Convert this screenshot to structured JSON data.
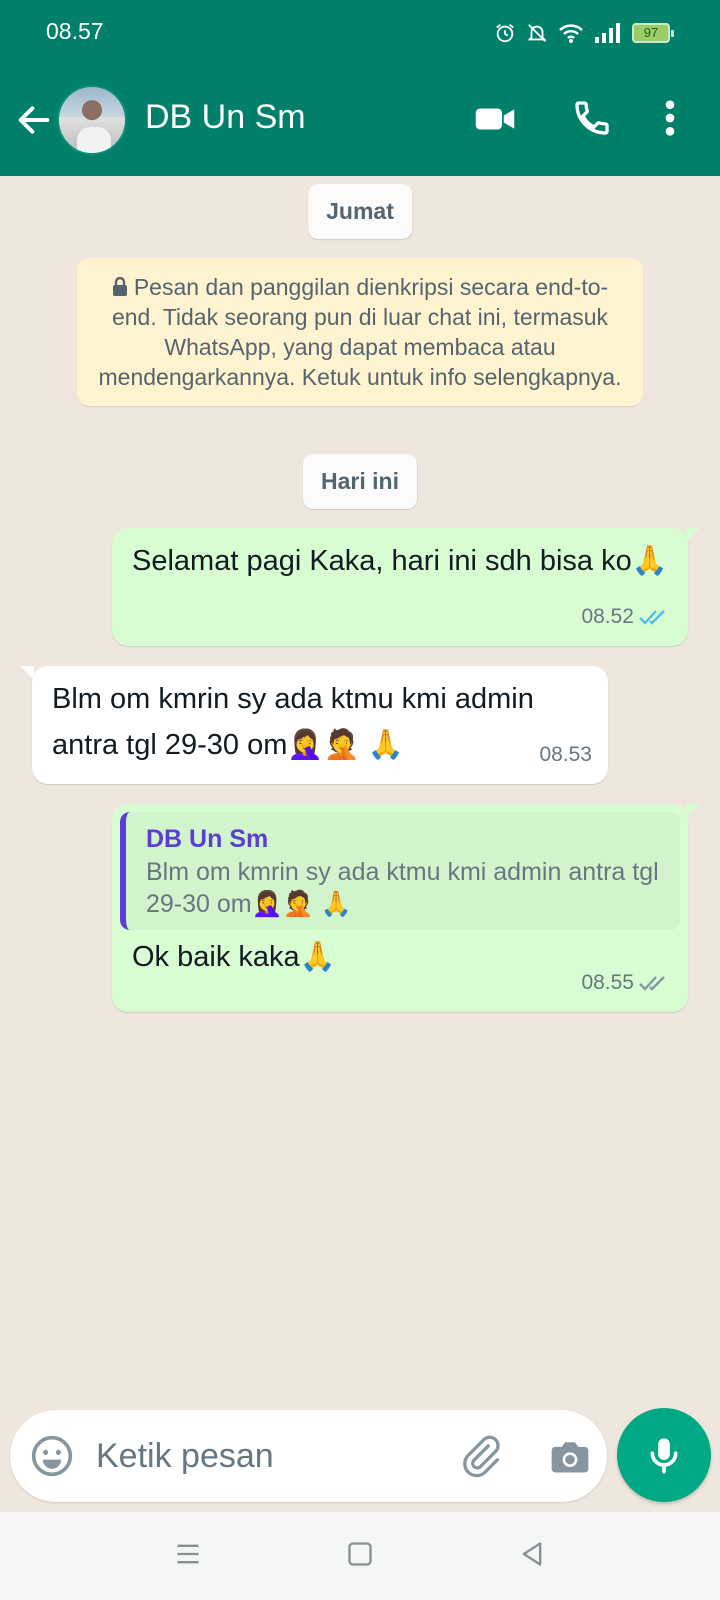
{
  "status_bar": {
    "time": "08.57",
    "battery": "97"
  },
  "header": {
    "contact_name": "DB Un Sm"
  },
  "chat": {
    "date_chip_1": "Jumat",
    "encryption_notice": "Pesan dan panggilan dienkripsi secara end-to-end. Tidak seorang pun di luar chat ini, termasuk WhatsApp, yang dapat membaca atau mendengarkannya. Ketuk untuk info selengkapnya.",
    "date_chip_2": "Hari ini",
    "messages": [
      {
        "direction": "outgoing",
        "text": "Selamat pagi Kaka, hari ini sdh bisa ko🙏",
        "time": "08.52",
        "status": "read"
      },
      {
        "direction": "incoming",
        "text": "Blm om kmrin sy ada ktmu kmi admin antra tgl 29-30 om🤦‍♀️🤦 🙏",
        "time": "08.53"
      },
      {
        "direction": "outgoing",
        "reply_to": {
          "name": "DB Un Sm",
          "text": "Blm om kmrin sy ada ktmu kmi admin antra tgl 29-30 om🤦‍♀️🤦 🙏"
        },
        "text": "Ok baik kaka🙏",
        "time": "08.55",
        "status": "delivered"
      }
    ]
  },
  "composer": {
    "placeholder": "Ketik pesan"
  },
  "colors": {
    "header": "#008069",
    "outgoing_bubble": "#d9fdd3",
    "incoming_bubble": "#ffffff",
    "read_ticks": "#53bdeb",
    "reply_accent": "#5b3fd4",
    "mic_button": "#00a884"
  }
}
